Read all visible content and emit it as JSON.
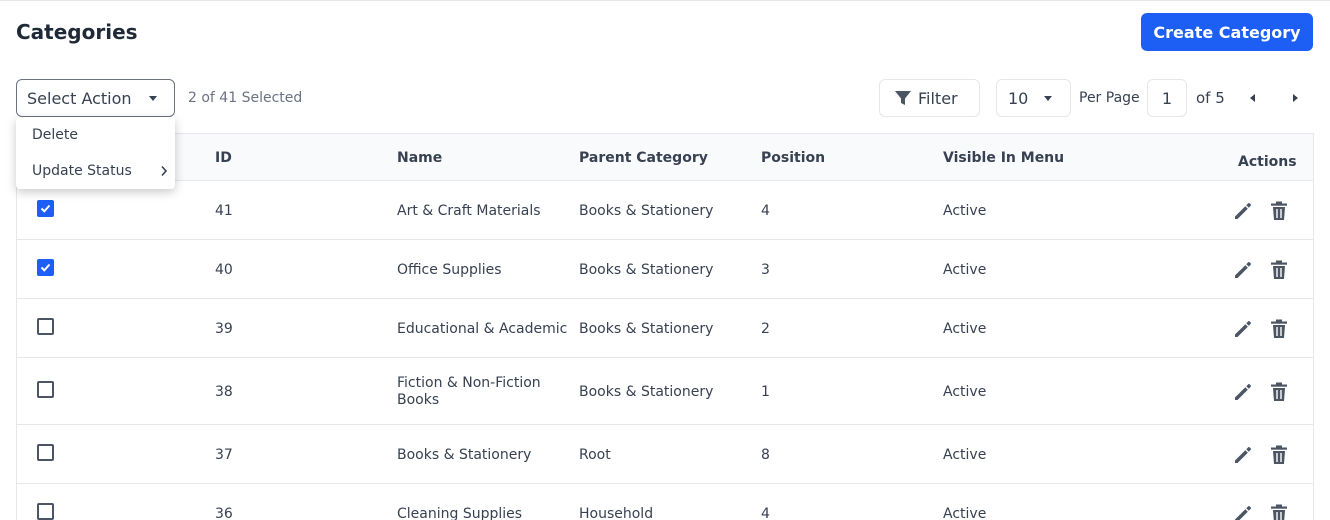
{
  "header": {
    "title": "Categories",
    "create_label": "Create Category"
  },
  "toolbar": {
    "select_action": "Select Action",
    "selected_text": "2 of 41 Selected",
    "filter_label": "Filter",
    "per_page_value": "10",
    "per_page_label": "Per Page",
    "page_value": "1",
    "page_of": "of 5"
  },
  "action_menu": {
    "items": [
      {
        "label": "Delete"
      },
      {
        "label": "Update Status"
      }
    ]
  },
  "table": {
    "columns": {
      "id": "ID",
      "name": "Name",
      "parent": "Parent Category",
      "position": "Position",
      "visible": "Visible In Menu",
      "actions": "Actions"
    },
    "rows": [
      {
        "id": "41",
        "name": "Art & Craft Materials",
        "parent": "Books & Stationery",
        "position": "4",
        "visible": "Active",
        "checked": true
      },
      {
        "id": "40",
        "name": "Office Supplies",
        "parent": "Books & Stationery",
        "position": "3",
        "visible": "Active",
        "checked": true
      },
      {
        "id": "39",
        "name": "Educational & Academic",
        "parent": "Books & Stationery",
        "position": "2",
        "visible": "Active",
        "checked": false
      },
      {
        "id": "38",
        "name": "Fiction & Non-Fiction Books",
        "parent": "Books & Stationery",
        "position": "1",
        "visible": "Active",
        "checked": false
      },
      {
        "id": "37",
        "name": "Books & Stationery",
        "parent": "Root",
        "position": "8",
        "visible": "Active",
        "checked": false
      },
      {
        "id": "36",
        "name": "Cleaning Supplies",
        "parent": "Household",
        "position": "4",
        "visible": "Active",
        "checked": false
      }
    ]
  },
  "colors": {
    "accent": "#1d5ff5",
    "text": "#374151",
    "border": "#e5e7eb",
    "icon": "#4b5563"
  },
  "icons": {
    "filter": "filter-icon",
    "edit": "pencil-icon",
    "delete": "trash-icon",
    "prev": "triangle-left-icon",
    "next": "triangle-right-icon"
  }
}
